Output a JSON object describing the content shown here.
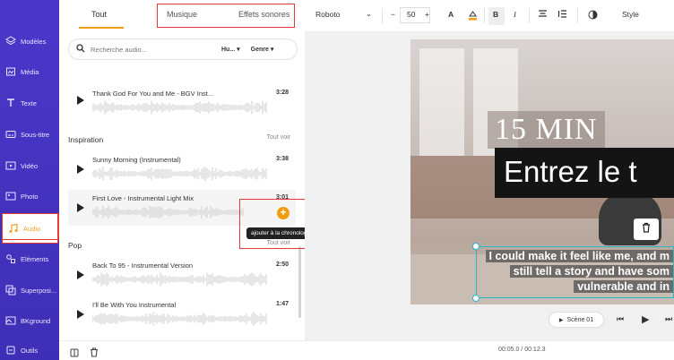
{
  "sidebar": {
    "items": [
      {
        "label": "Modèles",
        "icon": "layers-icon"
      },
      {
        "label": "Média",
        "icon": "media-icon"
      },
      {
        "label": "Texte",
        "icon": "text-icon"
      },
      {
        "label": "Sous-titre",
        "icon": "subtitle-icon"
      },
      {
        "label": "Vidéo",
        "icon": "video-icon"
      },
      {
        "label": "Photo",
        "icon": "photo-icon"
      },
      {
        "label": "Audio",
        "icon": "music-icon"
      },
      {
        "label": "Eléments",
        "icon": "elements-icon"
      },
      {
        "label": "Superposi...",
        "icon": "overlay-icon"
      },
      {
        "label": "BKground",
        "icon": "background-icon"
      },
      {
        "label": "Outils",
        "icon": "tools-icon"
      }
    ],
    "active": "Audio"
  },
  "panel": {
    "tabs": [
      "Tout",
      "Musique",
      "Effets sonores"
    ],
    "search_placeholder": "Recherche audio...",
    "filter_1": "Hu...",
    "filter_2": "Genre",
    "top_track": {
      "name": "Thank God For You and Me - BGV Inst...",
      "duration": "3:28"
    },
    "sections": [
      {
        "title": "Inspiration",
        "see_all": "Tout voir",
        "tracks": [
          {
            "name": "Sunny Morning (Instrumental)",
            "duration": "3:38"
          },
          {
            "name": "First Love - Instrumental Light Mix",
            "duration": "3:01"
          }
        ]
      },
      {
        "title": "Pop",
        "see_all": "Tout voir",
        "tracks": [
          {
            "name": "Back To 95 - Instrumental Version",
            "duration": "2:50"
          },
          {
            "name": "I'll Be With You Instrumental",
            "duration": "1:47"
          }
        ]
      }
    ],
    "tooltip": "ajouter à la chronologie",
    "add_symbol": "+"
  },
  "toolbar": {
    "font": "Roboto",
    "minus": "−",
    "font_size": "50",
    "plus": "+",
    "text_color": "A",
    "bold": "B",
    "italic": "I",
    "style": "Style"
  },
  "canvas": {
    "min_text": "15 MIN",
    "title_text": "Entrez le t",
    "subtitle_lines": [
      "I could make it feel like me, and m",
      "still tell a story and have som",
      "vulnerable and in"
    ],
    "scene_label": "Scène 01"
  },
  "timeline": {
    "time": "00:05.0 / 00:12.3"
  },
  "colors": {
    "sidebar": "#4b37c9",
    "accent": "#f39c12",
    "highlight": "#e53935",
    "selection": "#29b6c6"
  }
}
